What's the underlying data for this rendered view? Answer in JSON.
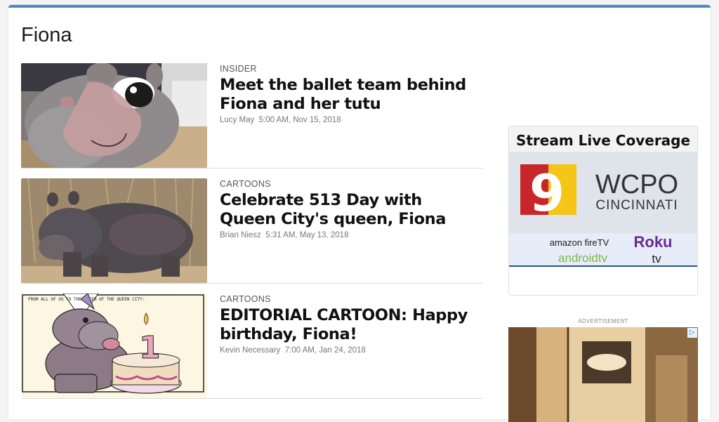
{
  "section": {
    "title": "Fiona"
  },
  "stories": [
    {
      "label": "INSIDER",
      "headline": "Meet the ballet team behind Fiona and her tutu",
      "author": "Lucy May",
      "time": "5:00 AM, Nov 15, 2018"
    },
    {
      "label": "CARTOONS",
      "headline": "Celebrate 513 Day with Queen City's queen, Fiona",
      "author": "Brian Niesz",
      "time": "5:31 AM, May 13, 2018"
    },
    {
      "label": "CARTOONS",
      "headline": "EDITORIAL CARTOON: Happy birthday, Fiona!",
      "author": "Kevin Necessary",
      "time": "7:00 AM, Jan 24, 2018"
    }
  ],
  "ad_top": {
    "banner": "Stream Live Coverage",
    "channel_number": "9",
    "station": "WCPO",
    "city": "CINCINNATI",
    "platforms": [
      "amazon fireTV",
      "Roku",
      "androidtv",
      "tv"
    ]
  },
  "ad_label": "ADVERTISEMENT",
  "cartoon_caption": "FROM ALL OF US TO THE QUEEN OF THE QUEEN CITY:",
  "birthday_number": "1",
  "colors": {
    "accent": "#4d8ac7",
    "wcpo_red": "#c8262b",
    "wcpo_yellow": "#f5c518",
    "roku": "#6c2a8f"
  }
}
